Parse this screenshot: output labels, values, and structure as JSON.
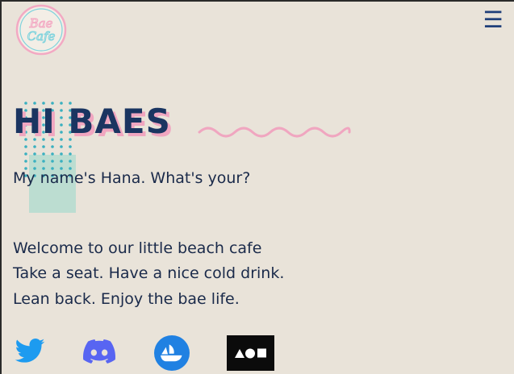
{
  "brand": {
    "logo_text": "Bae Cafe"
  },
  "hero": {
    "title": "HI BAES",
    "intro": "My name's Hana. What's your?",
    "lines": [
      "Welcome to our little beach cafe",
      "Take a seat. Have a nice cold drink.",
      "Lean back. Enjoy the bae life."
    ]
  },
  "colors": {
    "background": "#e9e3d9",
    "title": "#1a3561",
    "title_shadow": "#f0a6c0",
    "pink_accent": "#f0a6c0",
    "teal_accent": "#3ab0c0",
    "twitter": "#1d9bf0",
    "discord": "#5865f2",
    "opensea": "#2081e2"
  },
  "social": [
    {
      "icon": "twitter-icon"
    },
    {
      "icon": "discord-icon"
    },
    {
      "icon": "opensea-icon"
    },
    {
      "icon": "aoi-icon"
    }
  ]
}
